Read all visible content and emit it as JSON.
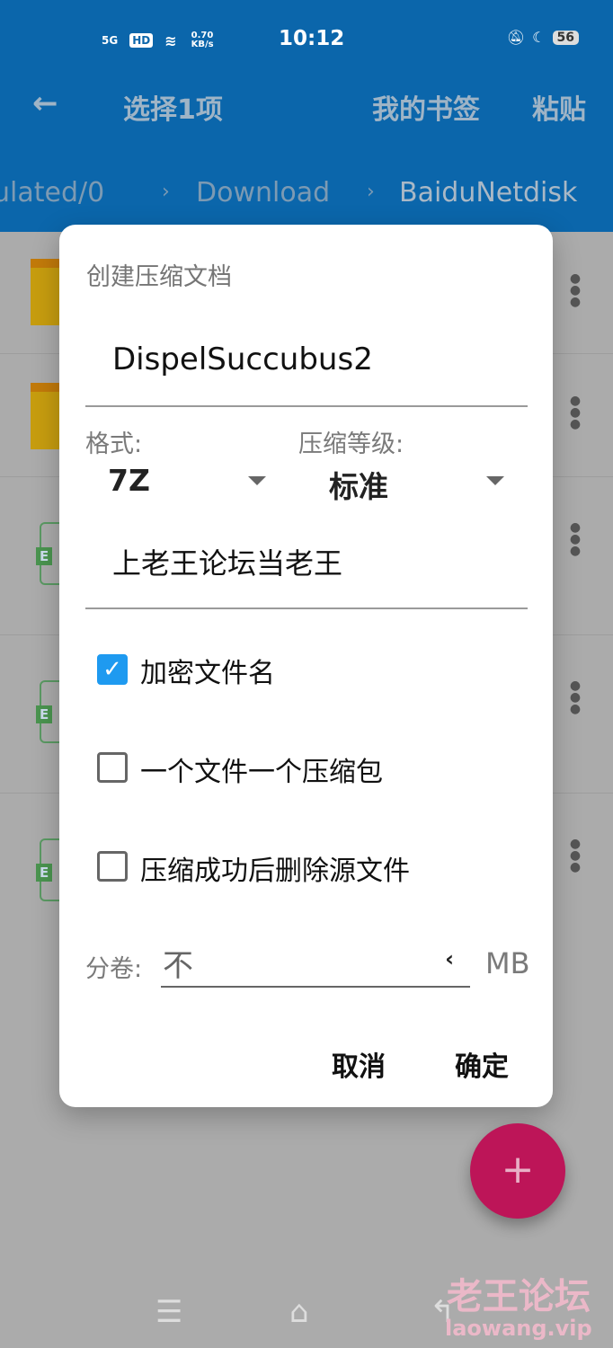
{
  "status_bar": {
    "network": "5G",
    "hd": "HD",
    "speed": "0.70 KB/s",
    "time": "10:12",
    "battery": "56"
  },
  "toolbar": {
    "title": "选择1项",
    "bookmarks": "我的书签",
    "paste": "粘贴"
  },
  "breadcrumb": [
    "ulated/0",
    "Download",
    "BaiduNetdisk"
  ],
  "file_list": {
    "rows": [
      {
        "type": "folder"
      },
      {
        "type": "folder"
      },
      {
        "type": "file",
        "badge": "E"
      },
      {
        "type": "file",
        "badge": "E"
      },
      {
        "type": "file",
        "badge": "E"
      }
    ]
  },
  "dialog": {
    "title": "创建压缩文档",
    "filename": "DispelSuccubus2",
    "format_label": "格式:",
    "format_value": "7Z",
    "level_label": "压缩等级:",
    "level_value": "标准",
    "password": "上老王论坛当老王",
    "options": [
      {
        "label": "加密文件名",
        "checked": true
      },
      {
        "label": "一个文件一个压缩包",
        "checked": false
      },
      {
        "label": "压缩成功后删除源文件",
        "checked": false
      }
    ],
    "split_label": "分卷:",
    "split_value": "不",
    "split_unit": "MB",
    "cancel": "取消",
    "ok": "确定"
  },
  "fab_icon": "plus-icon",
  "watermark": {
    "line1": "老王论坛",
    "line2": "laowang.vip"
  },
  "colors": {
    "header": "#0b66ab",
    "fab": "#bd1558",
    "checkbox": "#1e9af0"
  }
}
